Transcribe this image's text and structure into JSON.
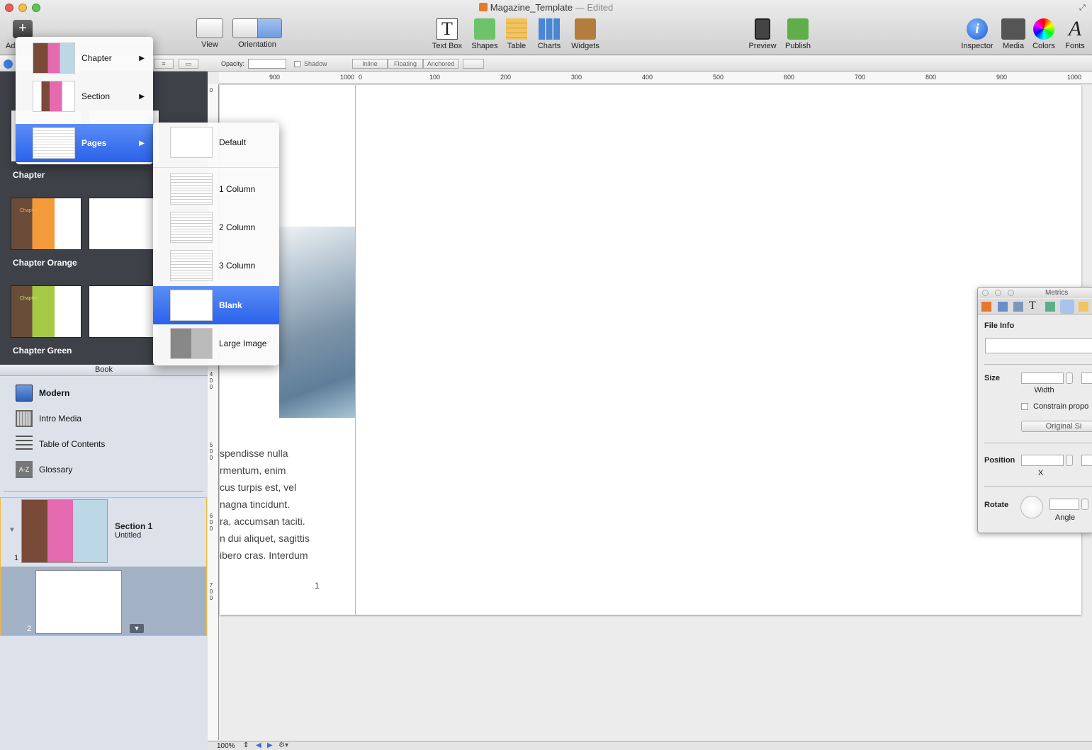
{
  "window": {
    "title": "Magazine_Template",
    "edited": "— Edited"
  },
  "toolbar": {
    "add_label": "Add",
    "view": "View",
    "orientation": "Orientation",
    "text_box": "Text Box",
    "shapes": "Shapes",
    "table": "Table",
    "charts": "Charts",
    "widgets": "Widgets",
    "preview": "Preview",
    "publish": "Publish",
    "inspector": "Inspector",
    "media": "Media",
    "colors": "Colors",
    "fonts": "Fonts"
  },
  "formatbar": {
    "opacity": "Opacity:",
    "shadow": "Shadow",
    "inline": "Inline",
    "floating": "Floating",
    "anchored": "Anchored"
  },
  "ruler": {
    "h_ticks": [
      "900",
      "1000",
      "0",
      "100",
      "200",
      "300",
      "400",
      "500",
      "600",
      "700",
      "800",
      "900",
      "1000"
    ],
    "v_labels": [
      "0",
      "4 0 0",
      "5 0 0",
      "6 0 0",
      "7 0 0"
    ]
  },
  "layouts": {
    "chapter": "Chapter",
    "orange": "Chapter Orange",
    "green": "Chapter Green",
    "thumb_text": "Chapter"
  },
  "book": {
    "header": "Book",
    "items": [
      "Modern",
      "Intro Media",
      "Table of Contents",
      "Glossary"
    ],
    "glossary_icon": "A-Z",
    "section_title": "Section 1",
    "section_sub": "Untitled",
    "section_num": "1",
    "page2_num": "2"
  },
  "menu": {
    "chapter": "Chapter",
    "section": "Section",
    "pages": "Pages",
    "arrow": "▶",
    "sub": [
      "Default",
      "1 Column",
      "2 Column",
      "3 Column",
      "Blank",
      "Large Image"
    ]
  },
  "page": {
    "lines": [
      "spendisse nulla",
      "rmentum, enim",
      "cus turpis est, vel",
      "nagna tincidunt.",
      "ra, accumsan taciti.",
      "n dui aliquet, sagittis",
      "ibero cras. Interdum"
    ],
    "page_number": "1"
  },
  "metrics": {
    "title": "Metrics",
    "file_info": "File Info",
    "size": "Size",
    "width": "Width",
    "constrain": "Constrain propo",
    "original": "Original Si",
    "position": "Position",
    "x": "X",
    "rotate": "Rotate",
    "angle": "Angle"
  },
  "status": {
    "zoom": "100%"
  },
  "colors": {
    "accent": "#2a62ea",
    "dark_sidebar": "#3e4148",
    "light_sidebar": "#dde2ea"
  }
}
